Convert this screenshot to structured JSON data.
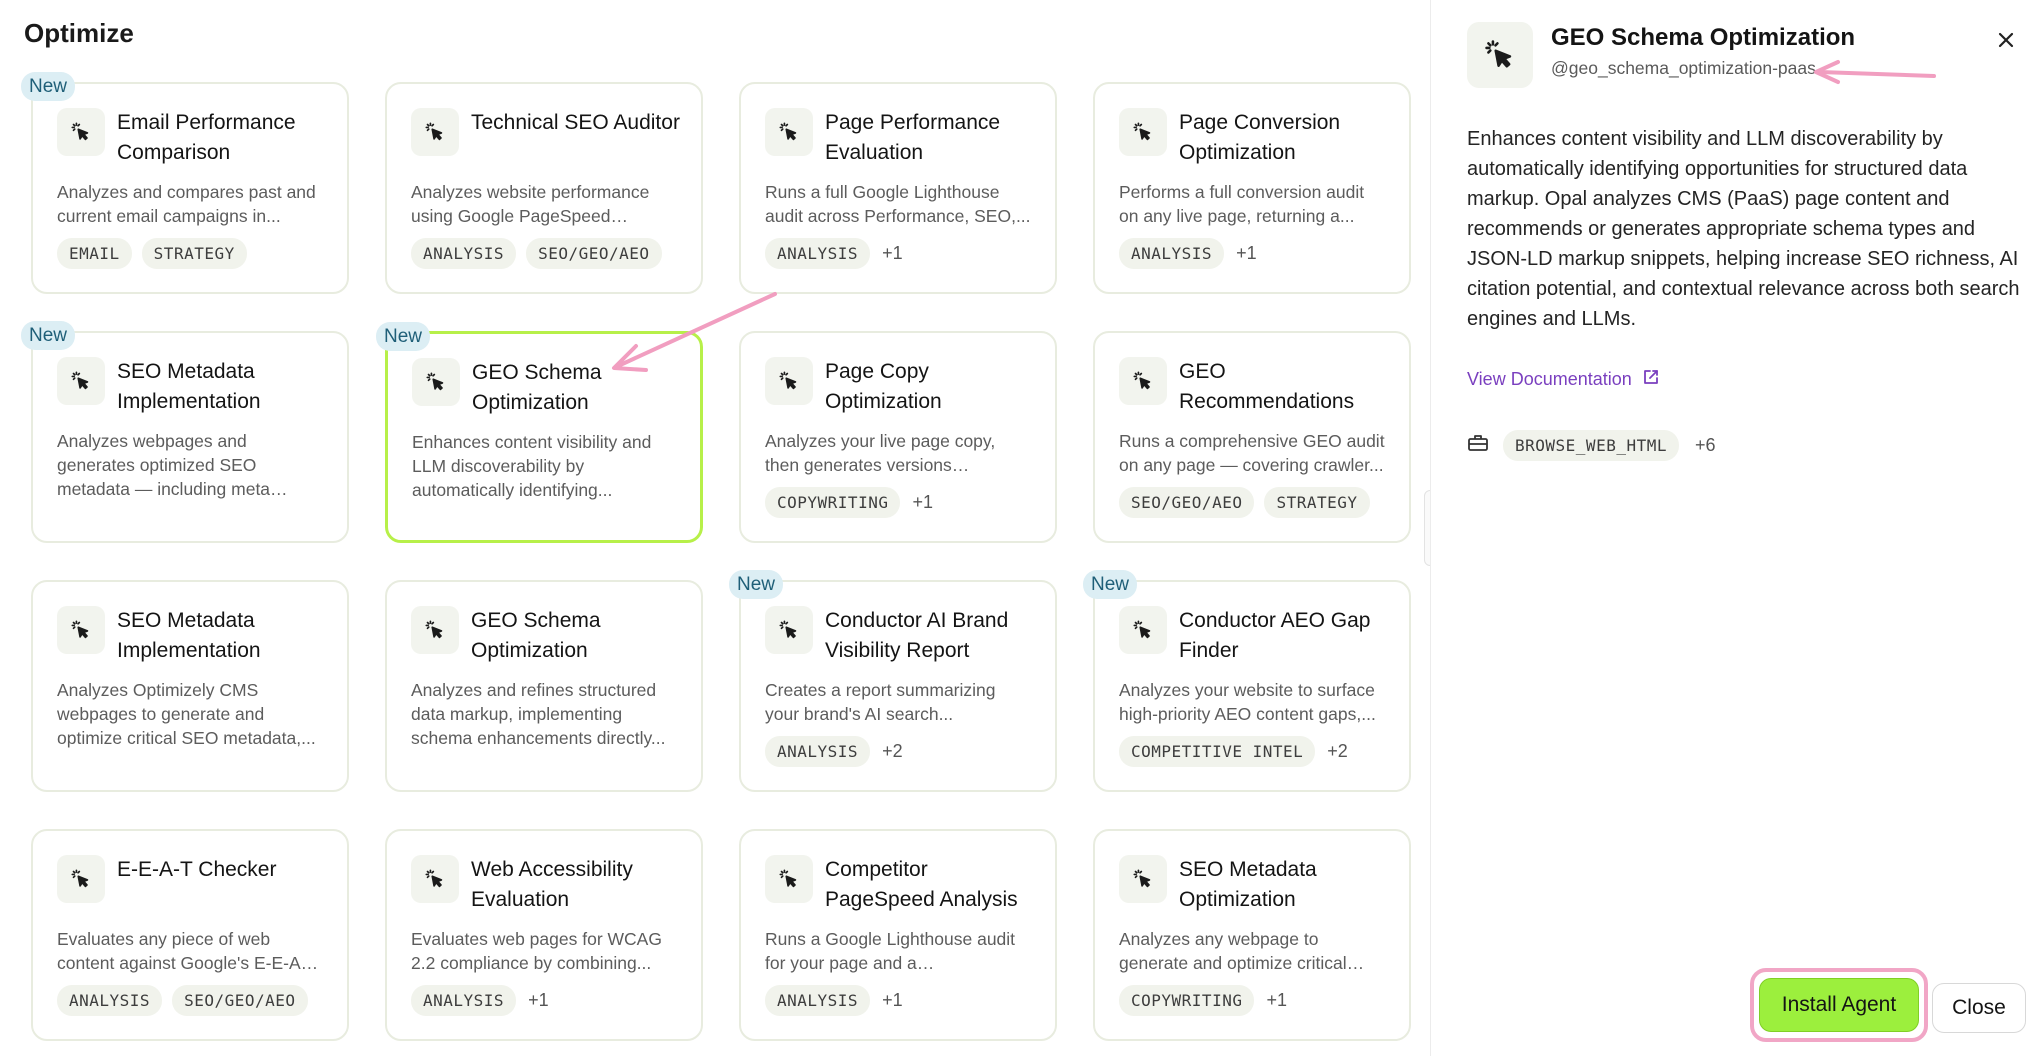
{
  "page": {
    "title": "Optimize"
  },
  "badge_new": "New",
  "cards": [
    {
      "title": "Email Performance Comparison",
      "desc": "Analyzes and compares past and current email campaigns in...",
      "tags": [
        "EMAIL",
        "STRATEGY"
      ],
      "more": "",
      "new": true
    },
    {
      "title": "Technical SEO Auditor",
      "desc": "Analyzes website performance using Google PageSpeed Insight...",
      "tags": [
        "ANALYSIS",
        "SEO/GEO/AEO"
      ],
      "more": "",
      "new": false
    },
    {
      "title": "Page Performance Evaluation",
      "desc": "Runs a full Google Lighthouse audit across Performance, SEO,...",
      "tags": [
        "ANALYSIS"
      ],
      "more": "+1",
      "new": false
    },
    {
      "title": "Page Conversion Optimization",
      "desc": "Performs a full conversion audit on any live page, returning a...",
      "tags": [
        "ANALYSIS"
      ],
      "more": "+1",
      "new": false
    },
    {
      "title": "SEO Metadata Implementation",
      "desc": "Analyzes webpages and generates optimized SEO metadata — including meta titles...",
      "tags": [],
      "more": "",
      "new": true
    },
    {
      "title": "GEO Schema Optimization",
      "desc": "Enhances content visibility and LLM discoverability by automatically identifying...",
      "tags": [],
      "more": "",
      "new": true
    },
    {
      "title": "Page Copy Optimization",
      "desc": "Analyzes your live page copy, then generates versions optimized for...",
      "tags": [
        "COPYWRITING"
      ],
      "more": "+1",
      "new": false
    },
    {
      "title": "GEO Recommendations",
      "desc": "Runs a comprehensive GEO audit on any page — covering crawler...",
      "tags": [
        "SEO/GEO/AEO",
        "STRATEGY"
      ],
      "more": "",
      "new": false
    },
    {
      "title": "SEO Metadata Implementation",
      "desc": "Analyzes Optimizely CMS webpages to generate and optimize critical SEO metadata,...",
      "tags": [],
      "more": "",
      "new": false
    },
    {
      "title": "GEO Schema Optimization",
      "desc": "Analyzes and refines structured data markup, implementing schema enhancements directly...",
      "tags": [],
      "more": "",
      "new": false
    },
    {
      "title": "Conductor AI Brand Visibility Report",
      "desc": "Creates a report summarizing your brand's AI search...",
      "tags": [
        "ANALYSIS"
      ],
      "more": "+2",
      "new": true
    },
    {
      "title": "Conductor AEO Gap Finder",
      "desc": "Analyzes your website to surface high-priority AEO content gaps,...",
      "tags": [
        "COMPETITIVE INTEL"
      ],
      "more": "+2",
      "new": true
    },
    {
      "title": "E-E-A-T Checker",
      "desc": "Evaluates any piece of web content against Google's E-E-A-T ...",
      "tags": [
        "ANALYSIS",
        "SEO/GEO/AEO"
      ],
      "more": "",
      "new": false
    },
    {
      "title": "Web Accessibility Evaluation",
      "desc": "Evaluates web pages for WCAG 2.2 compliance by combining...",
      "tags": [
        "ANALYSIS"
      ],
      "more": "+1",
      "new": false
    },
    {
      "title": "Competitor PageSpeed Analysis",
      "desc": "Runs a Google Lighthouse audit for your page and a competitor's,...",
      "tags": [
        "ANALYSIS"
      ],
      "more": "+1",
      "new": false
    },
    {
      "title": "SEO Metadata Optimization",
      "desc": "Analyzes any webpage to generate and optimize critical SE...",
      "tags": [
        "COPYWRITING"
      ],
      "more": "+1",
      "new": false
    }
  ],
  "panel": {
    "title": "GEO Schema Optimization",
    "handle": "@geo_schema_optimization-paas",
    "description": "Enhances content visibility and LLM discoverability by automatically identifying opportunities for structured data markup. Opal analyzes CMS (PaaS) page content and recommends or generates appropriate schema types and JSON-LD markup snippets, helping increase SEO richness, AI citation potential, and contextual relevance across both search engines and LLMs.",
    "doc_link": "View Documentation",
    "tool_tag": "BROWSE_WEB_HTML",
    "tool_more": "+6",
    "install_label": "Install Agent",
    "close_label": "Close"
  },
  "colors": {
    "accent_green": "#9cef3d",
    "selected_border": "#b7f049",
    "annotation_pink": "#f1a6c6",
    "link_purple": "#7a3fbf"
  },
  "icons": {
    "card": "sparkle-cursor-icon",
    "close": "close-icon",
    "external": "external-link-icon",
    "tools": "toolbox-icon"
  }
}
